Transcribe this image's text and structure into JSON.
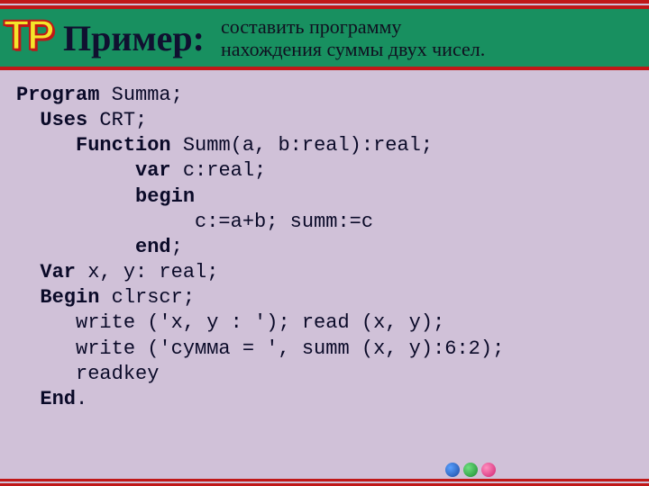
{
  "header": {
    "logo_t": "T",
    "logo_p": "P",
    "title": "Пример:",
    "subtitle_line1": "составить программу",
    "subtitle_line2": "нахождения суммы двух чисел."
  },
  "code": {
    "l1a": "Program",
    "l1b": " Summa;",
    "l2a": "  Uses",
    "l2b": " CRT;",
    "l3a": "     Function",
    "l3b": " Summ(a, b:real):real;",
    "l4a": "          var",
    "l4b": " c:real;",
    "l5a": "          begin",
    "l6": "               c:=a+b; summ:=c",
    "l7a": "          end",
    "l7b": ";",
    "l8a": "  Var",
    "l8b": " x, y: real;",
    "l9a": "  Begin",
    "l9b": " clrscr;",
    "l10": "     write ('x, y : '); read (x, y);",
    "l11": "     write ('сумма = ', summ (x, y):6:2);",
    "l12": "     readkey",
    "l13a": "  End",
    "l13b": "."
  }
}
